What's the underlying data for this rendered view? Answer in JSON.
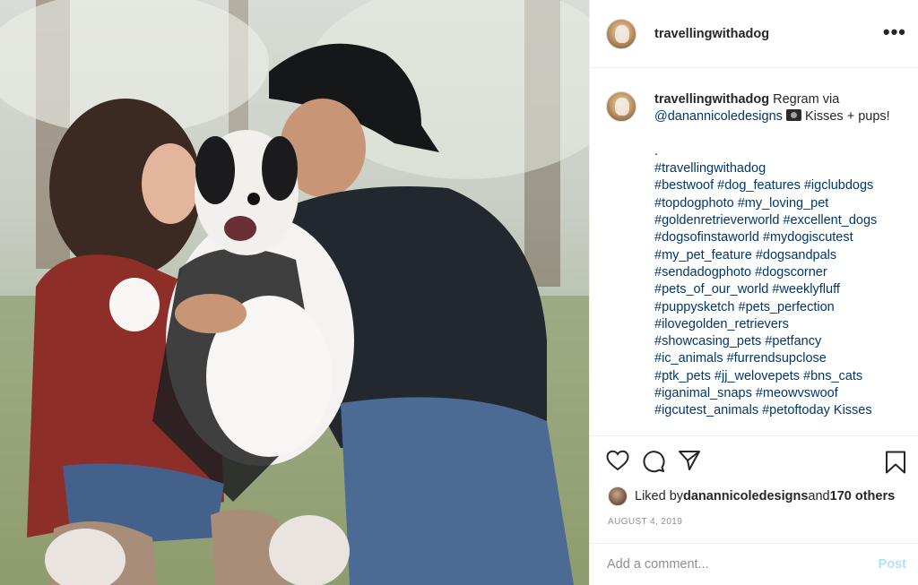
{
  "post": {
    "username": "travellingwithadog",
    "more_label": "•••",
    "photo_description_alt": ""
  },
  "caption": {
    "username": "travellingwithadog",
    "intro": " Regram via ",
    "mention": "@danannicoledesigns",
    "after_mention": " Kisses + pups!",
    "dot": ".",
    "hashtags": "#travellingwithadog\n#bestwoof #dog_features #igclubdogs\n#topdogphoto #my_loving_pet\n#goldenretrieverworld #excellent_dogs\n#dogsofinstaworld #mydogiscutest\n#my_pet_feature #dogsandpals\n#sendadogphoto #dogscorner\n#pets_of_our_world #weeklyfluff\n#puppysketch #pets_perfection\n#ilovegolden_retrievers\n#showcasing_pets #petfancy\n#ic_animals #furrendsupclose\n#ptk_pets #jj_welovepets #bns_cats\n#iganimal_snaps #meowvswoof\n#igcutest_animals #petoftoday Kisses"
  },
  "likes": {
    "prefix": "Liked by ",
    "user": "danannicoledesigns",
    "middle": " and ",
    "count": "170 others"
  },
  "date": "AUGUST 4, 2019",
  "comment": {
    "placeholder": "Add a comment...",
    "post_label": "Post"
  },
  "icons": {
    "like": "heart-icon",
    "comment": "comment-icon",
    "share": "send-icon",
    "save": "bookmark-icon"
  },
  "colors": {
    "link": "#00376b",
    "post_disabled": "#b2dffc",
    "muted": "#8e8e8e"
  }
}
